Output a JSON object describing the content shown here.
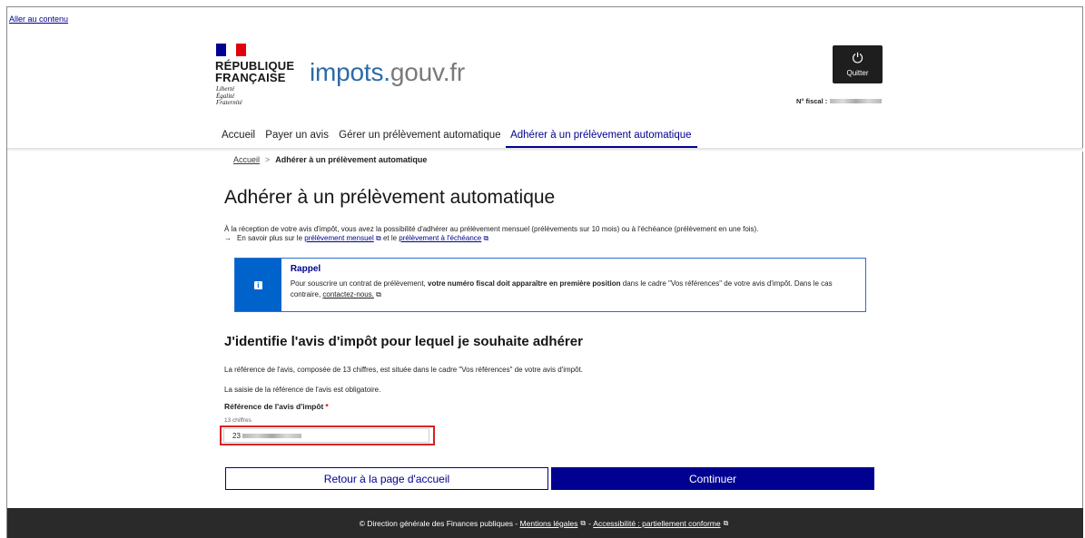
{
  "skip_link": "Aller au contenu",
  "brand": {
    "republique": "RÉPUBLIQUE",
    "francaise": "FRANÇAISE",
    "devise": [
      "Liberté",
      "Égalité",
      "Fraternité"
    ],
    "site_main": "impots.",
    "site_suffix": "gouv.fr",
    "flag_colors": [
      "#000091",
      "#ffffff",
      "#e1000f"
    ]
  },
  "quit": {
    "icon": "power-icon",
    "label": "Quitter"
  },
  "fiscal": {
    "label": "N° fiscal :"
  },
  "nav": {
    "items": [
      "Accueil",
      "Payer un avis",
      "Gérer un prélèvement automatique",
      "Adhérer à un prélèvement automatique"
    ],
    "active_index": 3
  },
  "breadcrumb": {
    "home": "Accueil",
    "separator": ">",
    "current": "Adhérer à un prélèvement automatique"
  },
  "title": "Adhérer à un prélèvement automatique",
  "intro": {
    "line1": "À la réception de votre avis d'impôt, vous avez la possibilité d'adhérer au prélèvement mensuel (prélèvements sur 10 mois) ou à l'échéance (prélèvement en une fois).",
    "arrow": "→",
    "line2_prefix": "En savoir plus sur le",
    "link1": "prélèvement mensuel",
    "between": "et le",
    "link2": "prélèvement à l'échéance"
  },
  "callout": {
    "icon": "info-icon",
    "title": "Rappel",
    "text_before": "Pour souscrire un contrat de prélèvement,",
    "text_bold": "votre numéro fiscal doit apparaître en première position",
    "text_after": "dans le cadre \"Vos références\" de votre avis d'impôt. Dans le cas contraire,",
    "link": "contactez-nous."
  },
  "section_title": "J'identifie l'avis d'impôt pour lequel je souhaite adhérer",
  "para1": "La référence de l'avis, composée de 13 chiffres, est située dans le cadre \"Vos références\" de votre avis d'impôt.",
  "para2": "La saisie de la référence de l'avis est obligatoire.",
  "field": {
    "label": "Référence de l'avis d'impôt",
    "required_mark": "*",
    "hint": "13 chiffres",
    "value_prefix": "23"
  },
  "buttons": {
    "back": "Retour à la page d'accueil",
    "continue": "Continuer"
  },
  "footer": {
    "text": "© Direction générale des Finances publiques -",
    "link1": "Mentions légales",
    "sep": "-",
    "link2": "Accessibilité : partiellement conforme"
  },
  "colors": {
    "primary": "#000091",
    "info": "#0063cb",
    "error": "#ce0500",
    "footer_bg": "#2a2a2a"
  }
}
